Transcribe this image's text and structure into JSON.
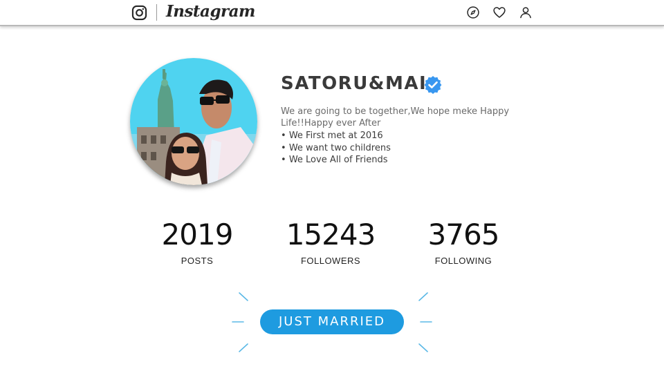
{
  "header": {
    "brand": "Instagram",
    "icons": [
      "instagram-camera-icon",
      "compass-icon",
      "heart-icon",
      "user-icon"
    ]
  },
  "profile": {
    "username": "SATORU&MAI",
    "verified": true,
    "bio": "We are going to be together,We hope meke Happy Life!!Happy ever After",
    "bullets": [
      "We First met at 2016",
      "We want two childrens",
      "We Love All of Friends"
    ]
  },
  "stats": {
    "posts": {
      "value": "2019",
      "label": "POSTS"
    },
    "followers": {
      "value": "15243",
      "label": "FOLLOWERS"
    },
    "following": {
      "value": "3765",
      "label": "FOLLOWING"
    }
  },
  "cta": {
    "label": "JUST MARRIED"
  },
  "colors": {
    "accent": "#1e9be0",
    "verified": "#3897f0"
  }
}
